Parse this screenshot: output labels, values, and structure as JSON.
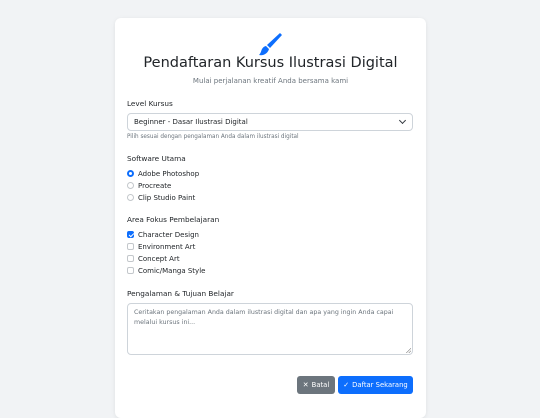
{
  "header": {
    "icon": "paintbrush-icon",
    "title": "Pendaftaran Kursus Ilustrasi Digital",
    "subtitle": "Mulai perjalanan kreatif Anda bersama kami"
  },
  "level": {
    "label": "Level Kursus",
    "selected": "Beginner - Dasar Ilustrasi Digital",
    "help": "Pilih sesuai dengan pengalaman Anda dalam ilustrasi digital"
  },
  "software": {
    "label": "Software Utama",
    "options": [
      {
        "label": "Adobe Photoshop",
        "checked": true
      },
      {
        "label": "Procreate",
        "checked": false
      },
      {
        "label": "Clip Studio Paint",
        "checked": false
      }
    ]
  },
  "focus": {
    "label": "Area Fokus Pembelajaran",
    "options": [
      {
        "label": "Character Design",
        "checked": true
      },
      {
        "label": "Environment Art",
        "checked": false
      },
      {
        "label": "Concept Art",
        "checked": false
      },
      {
        "label": "Comic/Manga Style",
        "checked": false
      }
    ]
  },
  "experience": {
    "label": "Pengalaman & Tujuan Belajar",
    "placeholder": "Ceritakan pengalaman Anda dalam ilustrasi digital dan apa yang ingin Anda capai melalui kursus ini..."
  },
  "actions": {
    "cancel_label": "Batal",
    "cancel_icon": "x-icon",
    "submit_label": "Daftar Sekarang",
    "submit_icon": "check-icon"
  },
  "colors": {
    "primary": "#0d6efd",
    "secondary": "#6c757d",
    "background": "#f1f3f5"
  }
}
